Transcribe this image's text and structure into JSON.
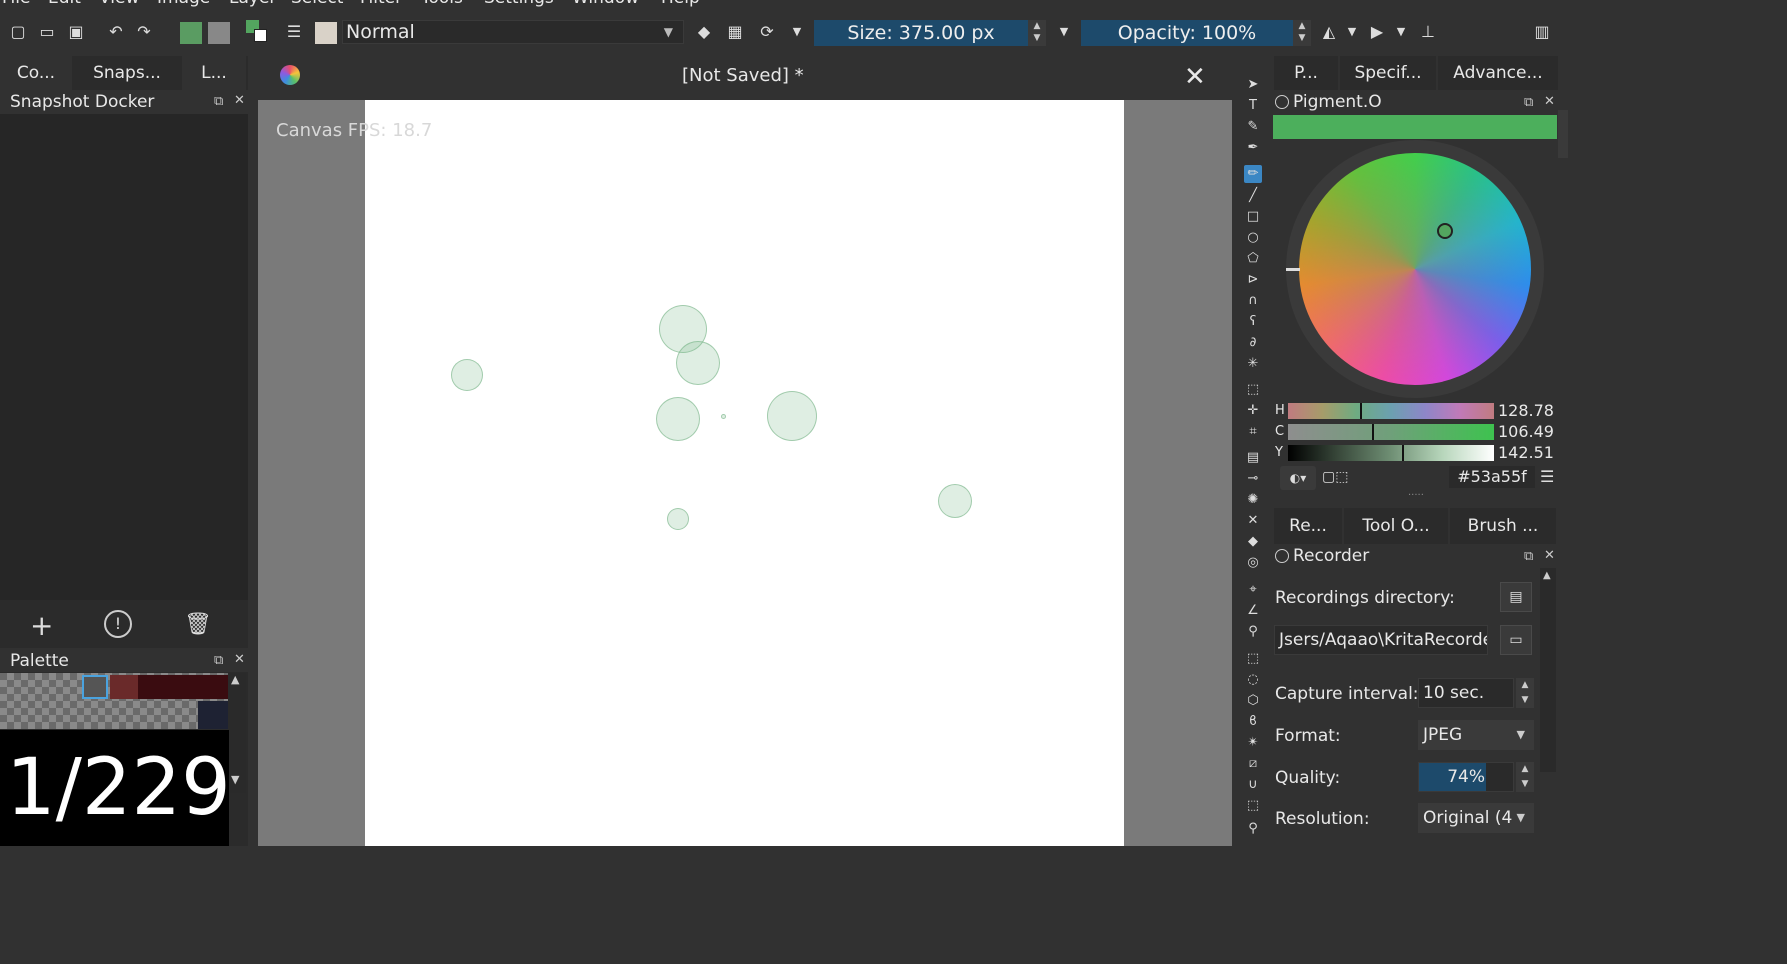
{
  "menu": [
    "File",
    "Edit",
    "View",
    "Image",
    "Layer",
    "Select",
    "Filter",
    "Tools",
    "Settings",
    "Window",
    "Help"
  ],
  "toolbar": {
    "blend_mode": "Normal",
    "size": "Size: 375.00 px",
    "opacity": "Opacity: 100%"
  },
  "left_dock": {
    "tabs": [
      "Co...",
      "Snaps...",
      "L..."
    ],
    "snapshot_title": "Snapshot Docker",
    "palette_title": "Palette"
  },
  "document": {
    "title": "[Not Saved]  *",
    "fps": "Canvas FPS: 18.7"
  },
  "right_dock": {
    "top_tabs": [
      "P...",
      "Specif...",
      "Advance..."
    ],
    "color_title": "Pigment.O",
    "current_color": "#53a55f",
    "hcy": [
      {
        "label": "H",
        "value": "128.78"
      },
      {
        "label": "C",
        "value": "106.49"
      },
      {
        "label": "Y",
        "value": "142.51"
      }
    ],
    "hex": "#53a55f",
    "mid_tabs": [
      "Re...",
      "Tool O...",
      "Brush ..."
    ],
    "recorder_title": "Recorder",
    "recordings_directory_label": "Recordings directory:",
    "recordings_directory_value": "Jsers/Aqaao\\KritaRecorder",
    "capture_interval_label": "Capture interval:",
    "capture_interval_value": "10 sec.",
    "format_label": "Format:",
    "format_value": "JPEG",
    "quality_label": "Quality:",
    "quality_value": "74%",
    "resolution_label": "Resolution:",
    "resolution_value": "Original (4"
  },
  "frame_counter": "1/229",
  "colors": {
    "accent": "#1d4a6b",
    "brush_green": "#53a55f",
    "bar_green": "#4caf5c"
  }
}
